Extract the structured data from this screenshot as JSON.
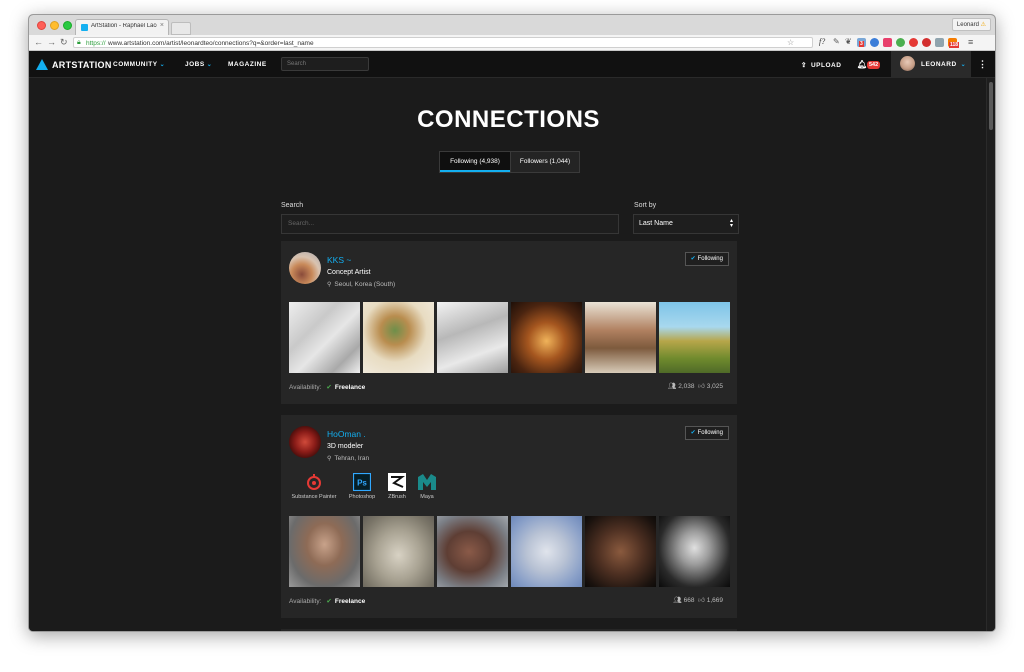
{
  "browser": {
    "tab_title": "ArtStation - Raphael Lacoste",
    "tab_close": "×",
    "profile_name": "Leonard",
    "url_scheme": "https://",
    "url_rest": "www.artstation.com/artist/leonardteo/connections?q=&order=last_name",
    "ext_badge_1": "3",
    "ext_badge_2": "118"
  },
  "nav": {
    "logo_text": "ARTSTATION",
    "community": "COMMUNITY",
    "jobs": "JOBS",
    "magazine": "MAGAZINE",
    "search_placeholder": "Search",
    "upload": "UPLOAD",
    "notifications": "542",
    "user": "LEONARD"
  },
  "page": {
    "title": "CONNECTIONS",
    "following_tab": "Following (4,938)",
    "followers_tab": "Followers (1,044)",
    "search_label": "Search",
    "search_placeholder": "Search...",
    "sort_label": "Sort by",
    "sort_value": "Last Name"
  },
  "connections": [
    {
      "name": "KKS ~",
      "role": "Concept Artist",
      "location": "Seoul, Korea (South)",
      "follow_label": "Following",
      "availability_label": "Availability:",
      "availability": "Freelance",
      "followers": "2,038",
      "likes": "3,025"
    },
    {
      "name": "HoOman .",
      "role": "3D modeler",
      "location": "Tehran, Iran",
      "follow_label": "Following",
      "software": [
        "Substance Painter",
        "Photoshop",
        "ZBrush",
        "Maya"
      ],
      "availability_label": "Availability:",
      "availability": "Freelance",
      "followers": "668",
      "likes": "1,669"
    }
  ],
  "colors": {
    "accent": "#13aff0",
    "background": "#1b1b1b",
    "card": "#262626",
    "available": "#4caf50"
  }
}
